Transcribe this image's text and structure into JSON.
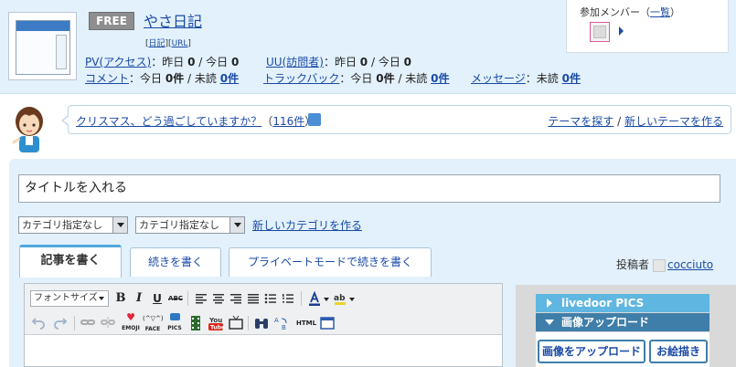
{
  "header": {
    "badge": "FREE",
    "blog_name": "やさ日記",
    "sub_links": [
      "日記",
      "URL"
    ],
    "pv_label": "PV(アクセス)",
    "pv_text_a": "：昨日",
    "pv_yesterday": "0",
    "pv_text_b": "/ 今日",
    "pv_today": "0",
    "uu_label": "UU(訪問者)",
    "uu_text_a": "：昨日",
    "uu_yesterday": "0",
    "uu_text_b": "/ 今日",
    "uu_today": "0",
    "comment_label": "コメント",
    "comment_text_a": "：今日",
    "comment_today": "0件",
    "comment_text_b": "/ 未読",
    "comment_unread": "0件",
    "trackback_label": "トラックバック",
    "trackback_text_a": "：今日",
    "trackback_today": "0件",
    "trackback_text_b": "/ 未読",
    "trackback_unread": "0件",
    "message_label": "メッセージ",
    "message_text_a": "：未読",
    "message_unread": "0件",
    "members_label_prefix": "参加メンバー（",
    "members_link": "一覧",
    "members_label_suffix": "）"
  },
  "theme": {
    "question": "クリスマス、どう過ごしていますか？",
    "count": "116件",
    "find_theme": "テーマを探す",
    "separator": "/",
    "new_theme": "新しいテーマを作る"
  },
  "editor": {
    "title_value": "タイトルを入れる",
    "category1": "カテゴリ指定なし",
    "category2": "カテゴリ指定なし",
    "new_category": "新しいカテゴリを作る",
    "tabs": [
      "記事を書く",
      "続きを書く",
      "プライベートモードで続きを書く"
    ],
    "poster_label": "投稿者",
    "poster_name": "cocciuto",
    "font_size": "フォントサイズ",
    "tb_bold": "B",
    "tb_italic": "I",
    "tb_underline": "U",
    "tb_strike": "ABC",
    "tb_emoji": "EMOJI",
    "tb_face": "FACE",
    "tb_face_glyph": "(^▽^)",
    "tb_pics": "PICS",
    "tb_html": "HTML"
  },
  "panel": {
    "pics": "livedoor PICS",
    "upload_header": "画像アップロード",
    "upload_button": "画像をアップロード",
    "draw_button": "お絵描き"
  }
}
